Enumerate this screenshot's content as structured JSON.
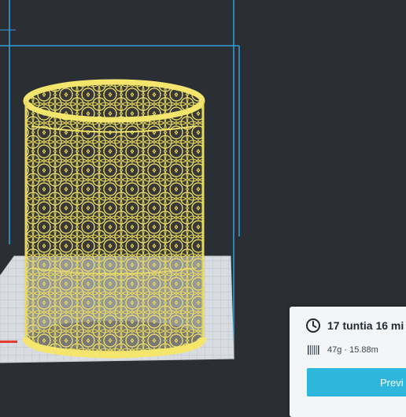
{
  "print_info": {
    "time": "17 tuntia 16 mi",
    "material": "47g · 15.88m",
    "preview_label": "Previ"
  },
  "icons": {
    "time": "clock-icon",
    "material": "spool-icon"
  },
  "colors": {
    "model": "#f0e266",
    "build_volume_lines": "#2e9bd6",
    "build_plate": "#d8dce1",
    "viewport_bg": "#2b2f33",
    "accent": "#2eb6dd"
  }
}
